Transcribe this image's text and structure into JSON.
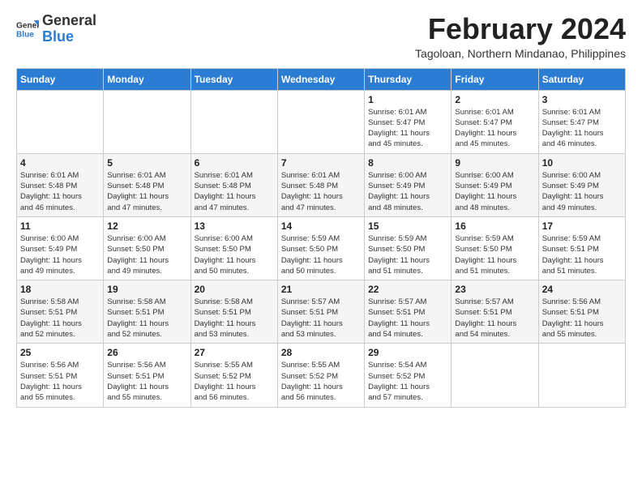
{
  "logo": {
    "line1": "General",
    "line2": "Blue"
  },
  "title": {
    "month_year": "February 2024",
    "location": "Tagoloan, Northern Mindanao, Philippines"
  },
  "weekdays": [
    "Sunday",
    "Monday",
    "Tuesday",
    "Wednesday",
    "Thursday",
    "Friday",
    "Saturday"
  ],
  "weeks": [
    [
      {
        "day": "",
        "info": ""
      },
      {
        "day": "",
        "info": ""
      },
      {
        "day": "",
        "info": ""
      },
      {
        "day": "",
        "info": ""
      },
      {
        "day": "1",
        "info": "Sunrise: 6:01 AM\nSunset: 5:47 PM\nDaylight: 11 hours\nand 45 minutes."
      },
      {
        "day": "2",
        "info": "Sunrise: 6:01 AM\nSunset: 5:47 PM\nDaylight: 11 hours\nand 45 minutes."
      },
      {
        "day": "3",
        "info": "Sunrise: 6:01 AM\nSunset: 5:47 PM\nDaylight: 11 hours\nand 46 minutes."
      }
    ],
    [
      {
        "day": "4",
        "info": "Sunrise: 6:01 AM\nSunset: 5:48 PM\nDaylight: 11 hours\nand 46 minutes."
      },
      {
        "day": "5",
        "info": "Sunrise: 6:01 AM\nSunset: 5:48 PM\nDaylight: 11 hours\nand 47 minutes."
      },
      {
        "day": "6",
        "info": "Sunrise: 6:01 AM\nSunset: 5:48 PM\nDaylight: 11 hours\nand 47 minutes."
      },
      {
        "day": "7",
        "info": "Sunrise: 6:01 AM\nSunset: 5:48 PM\nDaylight: 11 hours\nand 47 minutes."
      },
      {
        "day": "8",
        "info": "Sunrise: 6:00 AM\nSunset: 5:49 PM\nDaylight: 11 hours\nand 48 minutes."
      },
      {
        "day": "9",
        "info": "Sunrise: 6:00 AM\nSunset: 5:49 PM\nDaylight: 11 hours\nand 48 minutes."
      },
      {
        "day": "10",
        "info": "Sunrise: 6:00 AM\nSunset: 5:49 PM\nDaylight: 11 hours\nand 49 minutes."
      }
    ],
    [
      {
        "day": "11",
        "info": "Sunrise: 6:00 AM\nSunset: 5:49 PM\nDaylight: 11 hours\nand 49 minutes."
      },
      {
        "day": "12",
        "info": "Sunrise: 6:00 AM\nSunset: 5:50 PM\nDaylight: 11 hours\nand 49 minutes."
      },
      {
        "day": "13",
        "info": "Sunrise: 6:00 AM\nSunset: 5:50 PM\nDaylight: 11 hours\nand 50 minutes."
      },
      {
        "day": "14",
        "info": "Sunrise: 5:59 AM\nSunset: 5:50 PM\nDaylight: 11 hours\nand 50 minutes."
      },
      {
        "day": "15",
        "info": "Sunrise: 5:59 AM\nSunset: 5:50 PM\nDaylight: 11 hours\nand 51 minutes."
      },
      {
        "day": "16",
        "info": "Sunrise: 5:59 AM\nSunset: 5:50 PM\nDaylight: 11 hours\nand 51 minutes."
      },
      {
        "day": "17",
        "info": "Sunrise: 5:59 AM\nSunset: 5:51 PM\nDaylight: 11 hours\nand 51 minutes."
      }
    ],
    [
      {
        "day": "18",
        "info": "Sunrise: 5:58 AM\nSunset: 5:51 PM\nDaylight: 11 hours\nand 52 minutes."
      },
      {
        "day": "19",
        "info": "Sunrise: 5:58 AM\nSunset: 5:51 PM\nDaylight: 11 hours\nand 52 minutes."
      },
      {
        "day": "20",
        "info": "Sunrise: 5:58 AM\nSunset: 5:51 PM\nDaylight: 11 hours\nand 53 minutes."
      },
      {
        "day": "21",
        "info": "Sunrise: 5:57 AM\nSunset: 5:51 PM\nDaylight: 11 hours\nand 53 minutes."
      },
      {
        "day": "22",
        "info": "Sunrise: 5:57 AM\nSunset: 5:51 PM\nDaylight: 11 hours\nand 54 minutes."
      },
      {
        "day": "23",
        "info": "Sunrise: 5:57 AM\nSunset: 5:51 PM\nDaylight: 11 hours\nand 54 minutes."
      },
      {
        "day": "24",
        "info": "Sunrise: 5:56 AM\nSunset: 5:51 PM\nDaylight: 11 hours\nand 55 minutes."
      }
    ],
    [
      {
        "day": "25",
        "info": "Sunrise: 5:56 AM\nSunset: 5:51 PM\nDaylight: 11 hours\nand 55 minutes."
      },
      {
        "day": "26",
        "info": "Sunrise: 5:56 AM\nSunset: 5:51 PM\nDaylight: 11 hours\nand 55 minutes."
      },
      {
        "day": "27",
        "info": "Sunrise: 5:55 AM\nSunset: 5:52 PM\nDaylight: 11 hours\nand 56 minutes."
      },
      {
        "day": "28",
        "info": "Sunrise: 5:55 AM\nSunset: 5:52 PM\nDaylight: 11 hours\nand 56 minutes."
      },
      {
        "day": "29",
        "info": "Sunrise: 5:54 AM\nSunset: 5:52 PM\nDaylight: 11 hours\nand 57 minutes."
      },
      {
        "day": "",
        "info": ""
      },
      {
        "day": "",
        "info": ""
      }
    ]
  ]
}
